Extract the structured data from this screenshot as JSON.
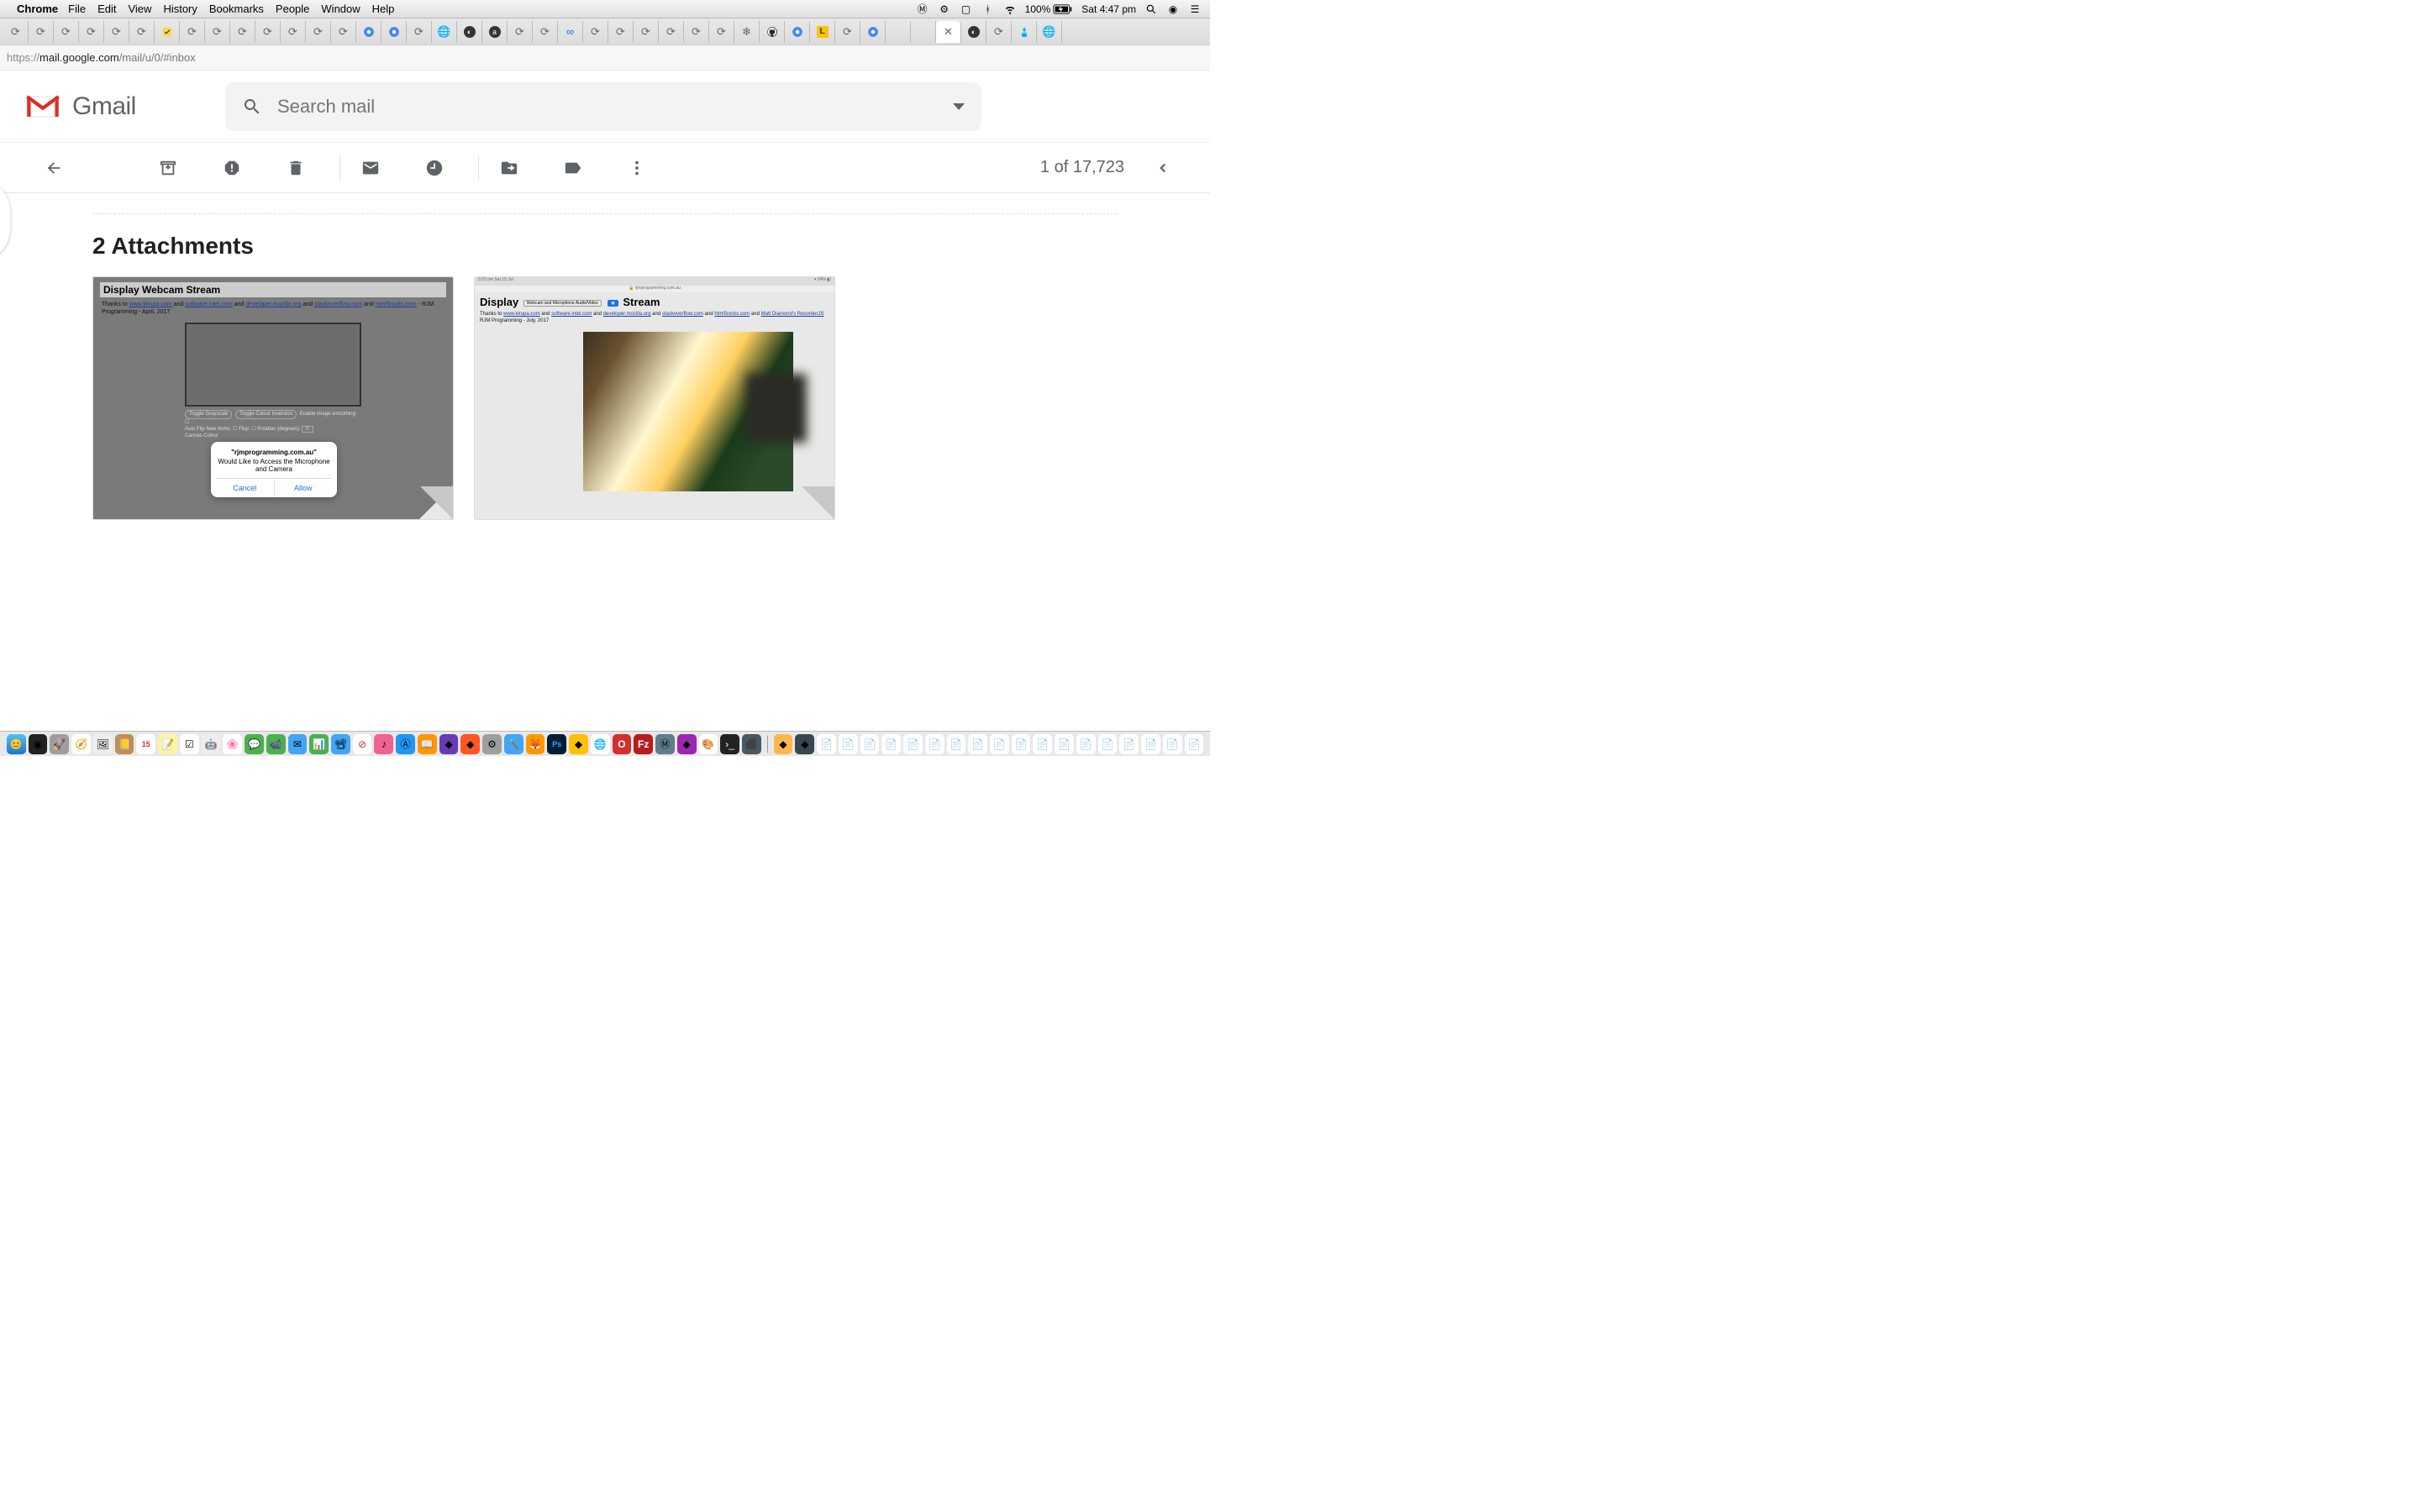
{
  "menubar": {
    "app": "Chrome",
    "items": [
      "File",
      "Edit",
      "View",
      "History",
      "Bookmarks",
      "People",
      "Window",
      "Help"
    ],
    "status": {
      "battery": "100%",
      "clock": "Sat 4:47 pm"
    }
  },
  "addressbar": {
    "secure_part": "https://",
    "host": "mail.google.com",
    "path": "/mail/u/0/#inbox"
  },
  "gmail": {
    "logo_text": "Gmail",
    "search_placeholder": "Search mail"
  },
  "toolbar": {
    "page_count": "1 of 17,723"
  },
  "attachments": {
    "title": "2 Attachments",
    "thumb1": {
      "heading": "Display Webcam Stream",
      "meta_prefix": "Thanks to ",
      "links": [
        "www.kirupa.com",
        "software.intel.com",
        "developer.mozilla.org",
        "stackoverflow.com",
        "html5rocks.com"
      ],
      "and": " and ",
      "suffix": " - RJM Programming - April, 2017",
      "ctl_pill1": "Toggle Grayscale",
      "ctl_pill2": "Toggle Colour Inversion",
      "ctl_label1": "Enable image smoothing:",
      "ctl_line2": "Auto Flip New Items: ☐  Flop: ☐  Rotation (degrees):",
      "ctl_rotval": "0",
      "ctl_line3": "Canvas Colour",
      "dialog_title": "\"rjmprogramming.com.au\"",
      "dialog_msg": "Would Like to Access the Microphone and Camera",
      "dialog_cancel": "Cancel",
      "dialog_allow": "Allow"
    },
    "thumb2": {
      "topbar_left": "5:52 pm  Sat 15 Jul",
      "topbar_right": "▾ 24% ◧",
      "urlrow": "🔒 rjmprogramming.com.au",
      "heading_pre": "Display",
      "heading_pill": "Webcam and Microphone Audio/Video",
      "heading_recbtn": "◉",
      "heading_post": "Stream",
      "meta_prefix": "Thanks to ",
      "links": [
        "www.kirupa.com",
        "software.intel.com",
        "developer.mozilla.org",
        "stackoverflow.com",
        "html5rocks.com",
        "Matt Diamond's RecorderJS"
      ],
      "and": " and ",
      "line2": "RJM Programming - July, 2017"
    }
  }
}
